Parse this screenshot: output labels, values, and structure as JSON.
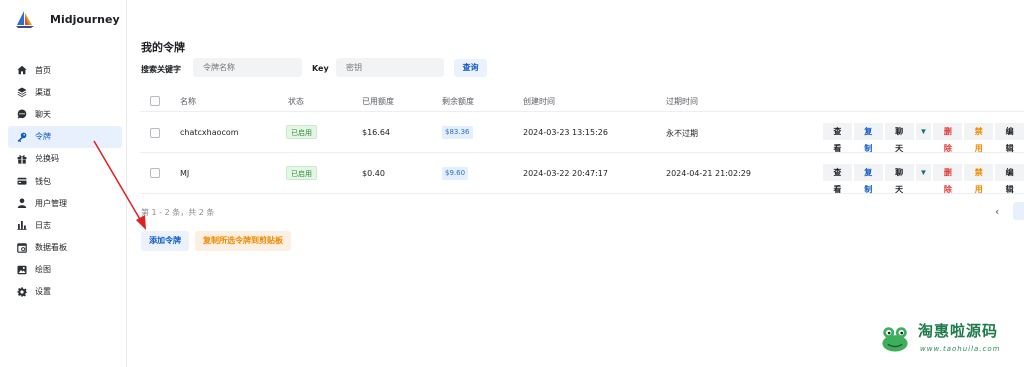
{
  "app": {
    "name": "Midjourney"
  },
  "sidebar": {
    "items": [
      {
        "label": "首页",
        "icon": "home-icon"
      },
      {
        "label": "渠道",
        "icon": "layers-icon"
      },
      {
        "label": "聊天",
        "icon": "chat-bubble-icon"
      },
      {
        "label": "令牌",
        "icon": "key-icon",
        "active": true
      },
      {
        "label": "兑换码",
        "icon": "gift-icon"
      },
      {
        "label": "钱包",
        "icon": "wallet-icon"
      },
      {
        "label": "用户管理",
        "icon": "user-icon"
      },
      {
        "label": "日志",
        "icon": "bar-chart-icon"
      },
      {
        "label": "数据看板",
        "icon": "dashboard-icon"
      },
      {
        "label": "绘图",
        "icon": "image-icon"
      },
      {
        "label": "设置",
        "icon": "gear-icon"
      }
    ]
  },
  "page": {
    "title": "我的令牌",
    "search": {
      "label": "搜索关键字",
      "placeholder": "令牌名称",
      "key_label": "Key",
      "key_placeholder": "密钥",
      "query_button": "查询"
    },
    "table": {
      "columns": [
        "名称",
        "状态",
        "已用额度",
        "剩余额度",
        "创建时间",
        "过期时间"
      ],
      "rows": [
        {
          "name": "chatcxhaocom",
          "status": "已启用",
          "used": "$16.64",
          "remaining": "$83.36",
          "created": "2024-03-23 13:15:26",
          "expires": "永不过期"
        },
        {
          "name": "MJ",
          "status": "已启用",
          "used": "$0.40",
          "remaining": "$9.60",
          "created": "2024-03-22 20:47:17",
          "expires": "2024-04-21 21:02:29"
        }
      ],
      "actions": {
        "view": "查看",
        "copy": "复制",
        "chat": "聊天",
        "caret": "▼",
        "delete": "删除",
        "disable": "禁用",
        "edit": "编辑"
      }
    },
    "summary": "第 1 - 2 条，共 2 条",
    "pager_prev": "‹",
    "add_button": "添加令牌",
    "copy_selected_button": "复制所选令牌到剪贴板"
  },
  "watermark": {
    "title": "淘惠啦源码",
    "url": "www.taohuila.com"
  },
  "colors": {
    "accent": "#0e5ac8",
    "annotation_arrow": "#e02020",
    "enabled_tag": "#2f8b3a",
    "danger": "#e53935",
    "warning": "#ee8a00"
  }
}
